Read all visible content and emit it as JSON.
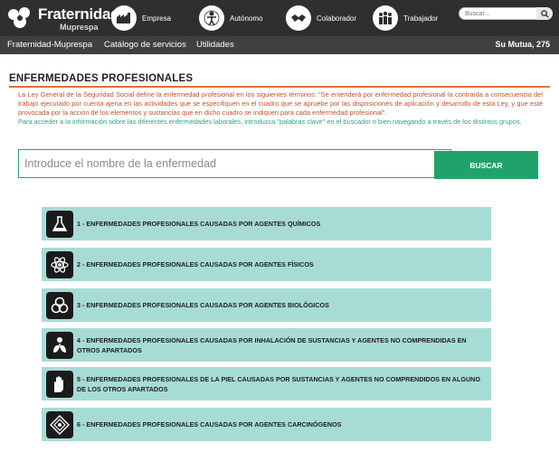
{
  "header": {
    "logo_name": "Fraternidad",
    "logo_sub": "Muprespa",
    "nav": [
      {
        "label": "Empresa",
        "icon": "factory-icon"
      },
      {
        "label": "Autónomo",
        "icon": "person-icon"
      },
      {
        "label": "Colaborador",
        "icon": "handshake-icon"
      },
      {
        "label": "Trabajador",
        "icon": "workers-icon"
      }
    ],
    "search_placeholder": "Buscar...",
    "search_icon": "search-icon"
  },
  "subnav": {
    "items": [
      "Fraternidad-Muprespa",
      "Catálogo de servicios",
      "Utilidades"
    ],
    "mutua": "Su Mutua, 275"
  },
  "main": {
    "title": "ENFERMEDADES PROFESIONALES",
    "intro": "La Ley General de la Seguridad Social define la enfermedad profesional en los siguientes términos: \"Se entenderá por enfermedad profesional la contraída a consecuencia del trabajo ejecutado por cuenta ajena en las actividades que se especifiquen en el cuadro que se apruebe por las disposiciones de aplicación y desarrollo de esta Ley, y que esté provocada por la acción de los elementos y sustancias que en dicho cuadro se indiquen para cada enfermedad profesional\".",
    "intro_help": "Para acceder a la información sobre las diferentes enfermedades laborales, introduzca \"palabras clave\" en el buscador o bien navegando a través de los distintos grupos.",
    "search_placeholder": "Introduce el nombre de la enfermedad",
    "search_button": "BUSCAR",
    "groups": [
      {
        "label": "1 - ENFERMEDADES PROFESIONALES CAUSADAS POR AGENTES QUÍMICOS",
        "icon": "flask-icon"
      },
      {
        "label": "2 - ENFERMEDADES PROFESIONALES CAUSADAS POR AGENTES FÍSICOS",
        "icon": "atom-icon"
      },
      {
        "label": "3 - ENFERMEDADES PROFESIONALES CAUSADAS POR AGENTES BIOLÓGICOS",
        "icon": "biohazard-icon"
      },
      {
        "label": "4 - ENFERMEDADES PROFESIONALES CAUSADAS POR INHALACIÓN DE SUSTANCIAS Y AGENTES NO COMPRENDIDAS EN OTROS APARTADOS",
        "icon": "lungs-icon"
      },
      {
        "label": "5 - ENFERMEDADES PROFESIONALES DE LA PIEL CAUSADAS POR SUSTANCIAS Y AGENTES NO COMPRENDIDOS EN ALGUNO DE LOS OTROS APARTADOS",
        "icon": "hand-icon"
      },
      {
        "label": "6 - ENFERMEDADES PROFESIONALES CAUSADAS POR AGENTES CARCINÓGENOS",
        "icon": "carcinogen-icon"
      }
    ]
  },
  "colors": {
    "topbar": "#2f2f2f",
    "subbar": "#404040",
    "accent_orange": "#e0733a",
    "intro_text": "#c0532a",
    "green": "#1fa36a",
    "group_bg": "#a7dcd6"
  }
}
